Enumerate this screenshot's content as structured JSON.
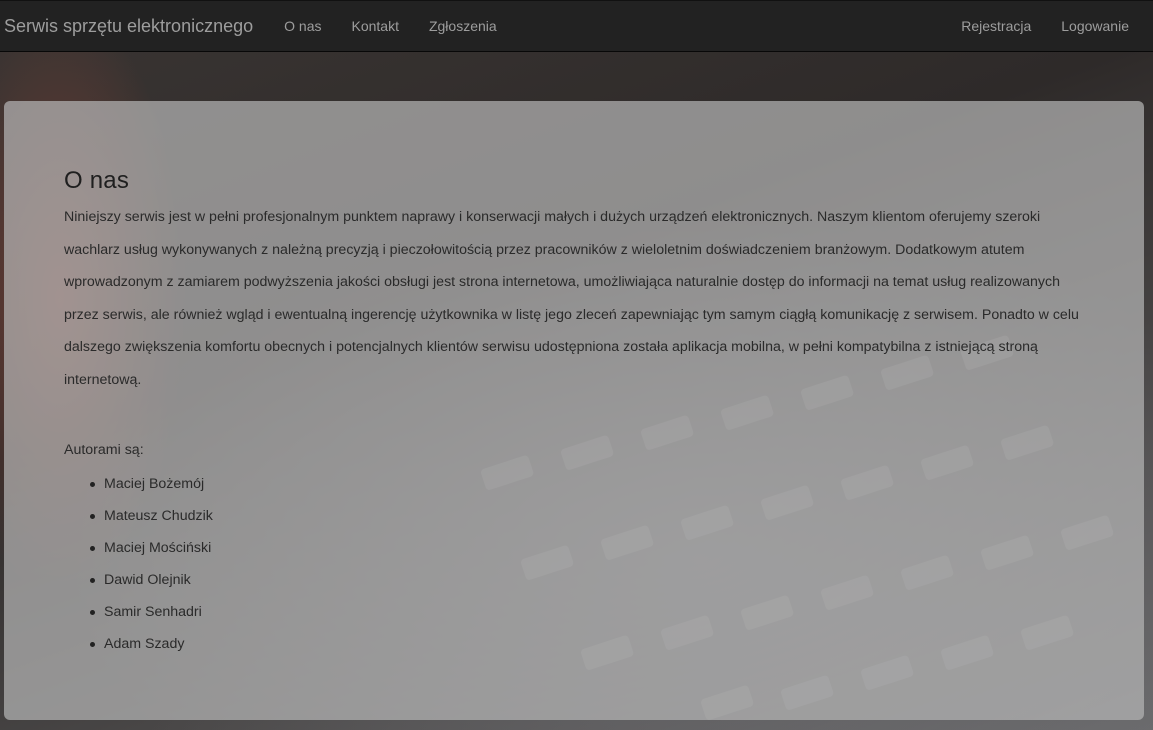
{
  "navbar": {
    "brand": "Serwis sprzętu elektronicznego",
    "left_links": [
      "O nas",
      "Kontakt",
      "Zgłoszenia"
    ],
    "right_links": [
      "Rejestracja",
      "Logowanie"
    ]
  },
  "main": {
    "title": "O nas",
    "description": "Niniejszy serwis jest w pełni profesjonalnym punktem naprawy i konserwacji małych i dużych urządzeń elektronicznych. Naszym klientom oferujemy szeroki wachlarz usług wykonywanych z należną precyzją i pieczołowitością przez pracowników z wieloletnim doświadczeniem branżowym. Dodatkowym atutem wprowadzonym z zamiarem podwyższenia jakości obsługi jest strona internetowa, umożliwiająca naturalnie dostęp do informacji na temat usług realizowanych przez serwis, ale również wgląd i ewentualną ingerencję użytkownika w listę jego zleceń zapewniając tym samym ciągłą komunikację z serwisem. Ponadto w celu dalszego zwiększenia komfortu obecnych i potencjalnych klientów serwisu udostępniona została aplikacja mobilna, w pełni kompatybilna z istniejącą stroną internetową.",
    "authors_label": "Autorami są:",
    "authors": [
      "Maciej Bożemój",
      "Mateusz Chudzik",
      "Maciej Mościński",
      "Dawid Olejnik",
      "Samir Senhadri",
      "Adam Szady"
    ]
  },
  "colors": {
    "navbar_bg": "#222222",
    "nav_text": "#9d9d9d",
    "panel_bg": "#b4b4b4"
  }
}
